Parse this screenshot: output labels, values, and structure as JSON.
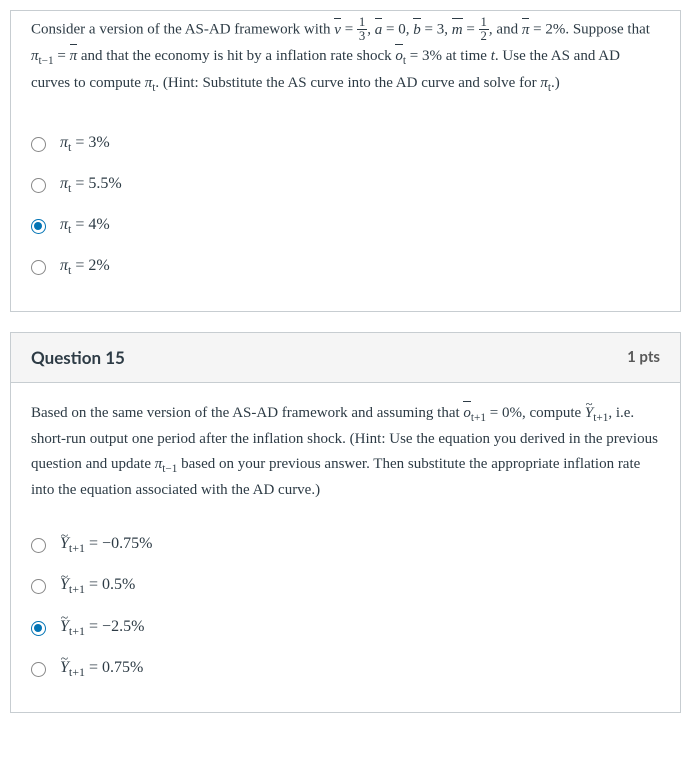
{
  "q14": {
    "text_intro": "Consider a version of the AS-AD framework with ",
    "text_and": ", and ",
    "text_suppose": ". Suppose that ",
    "text_economy": " and that the economy is hit by a inflation rate shock ",
    "text_attime": " at time ",
    "text_useas": ". Use the AS and AD curves to compute ",
    "text_hint": ". (Hint: Substitute the AS curve into the AD curve and solve for ",
    "text_hintend": ".)",
    "vbar_eq": " = ",
    "frac13_num": "1",
    "frac13_den": "3",
    "comma_abar": ", ",
    "abar_eq": " = 0, ",
    "bbar_eq": " = 3, ",
    "mbar_eq": " = ",
    "frac12_num": "1",
    "frac12_den": "2",
    "pibar_eq": " = 2%",
    "pi_tm1_eq": " = ",
    "obar_t_eq": " = 3%",
    "t_var": "t",
    "options": {
      "a": " = 3%",
      "b": " = 5.5%",
      "c": " = 4%",
      "d": " = 2%"
    }
  },
  "q15": {
    "title": "Question 15",
    "points": "1 pts",
    "text_intro": "Based on the same version of the AS-AD framework and assuming that ",
    "obar_tp1_eq": " = 0%",
    "text_compute": ", compute ",
    "text_ie": ", i.e. short-run output one period after the inflation shock. (Hint: Use the equation you derived in the previous question and update ",
    "text_based": " based on your previous answer. Then substitute the appropriate inflation rate into the equation associated with the AD curve.)",
    "options": {
      "a": " = −0.75%",
      "b": " = 0.5%",
      "c": " = −2.5%",
      "d": " = 0.75%"
    }
  }
}
